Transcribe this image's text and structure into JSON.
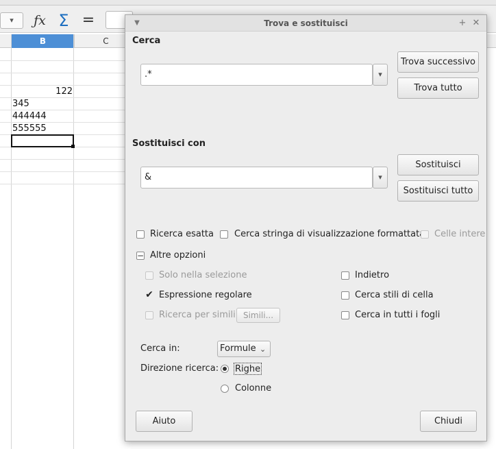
{
  "spreadsheet": {
    "columns": {
      "b": "B",
      "c": "C"
    },
    "cells": [
      "122",
      "345",
      "444444",
      "555555"
    ]
  },
  "dialog": {
    "title": "Trova e sostituisci",
    "search": {
      "label": "Cerca",
      "value": ".*",
      "find_next_label": "Trova successivo",
      "find_all_label": "Trova tutto"
    },
    "replace": {
      "label": "Sostituisci con",
      "value": "&",
      "replace_label": "Sostituisci",
      "replace_all_label": "Sostituisci tutto"
    },
    "options": {
      "match_case": {
        "label": "Ricerca esatta",
        "checked": false
      },
      "formatted_display": {
        "label": "Cerca stringa di visualizzazione formattata",
        "checked": false
      },
      "entire_cells": {
        "label": "Celle intere",
        "checked": false,
        "disabled": true
      },
      "other_options_label": "Altre opzioni",
      "current_selection": {
        "label": "Solo nella selezione",
        "checked": false,
        "disabled": true
      },
      "backwards": {
        "label": "Indietro",
        "checked": false
      },
      "regex": {
        "label": "Espressione regolare",
        "checked": true
      },
      "cell_styles": {
        "label": "Cerca stili di cella",
        "checked": false
      },
      "similarity": {
        "label": "Ricerca per simili",
        "checked": false,
        "disabled": true
      },
      "similarity_button_label": "Simili...",
      "all_sheets": {
        "label": "Cerca in tutti i fogli",
        "checked": false
      }
    },
    "search_in": {
      "label": "Cerca in:",
      "value": "Formule"
    },
    "direction": {
      "label": "Direzione ricerca:",
      "rows_label": "Righe",
      "columns_label": "Colonne",
      "selected": "Righe"
    },
    "help_label": "Aiuto",
    "close_label": "Chiudi"
  }
}
